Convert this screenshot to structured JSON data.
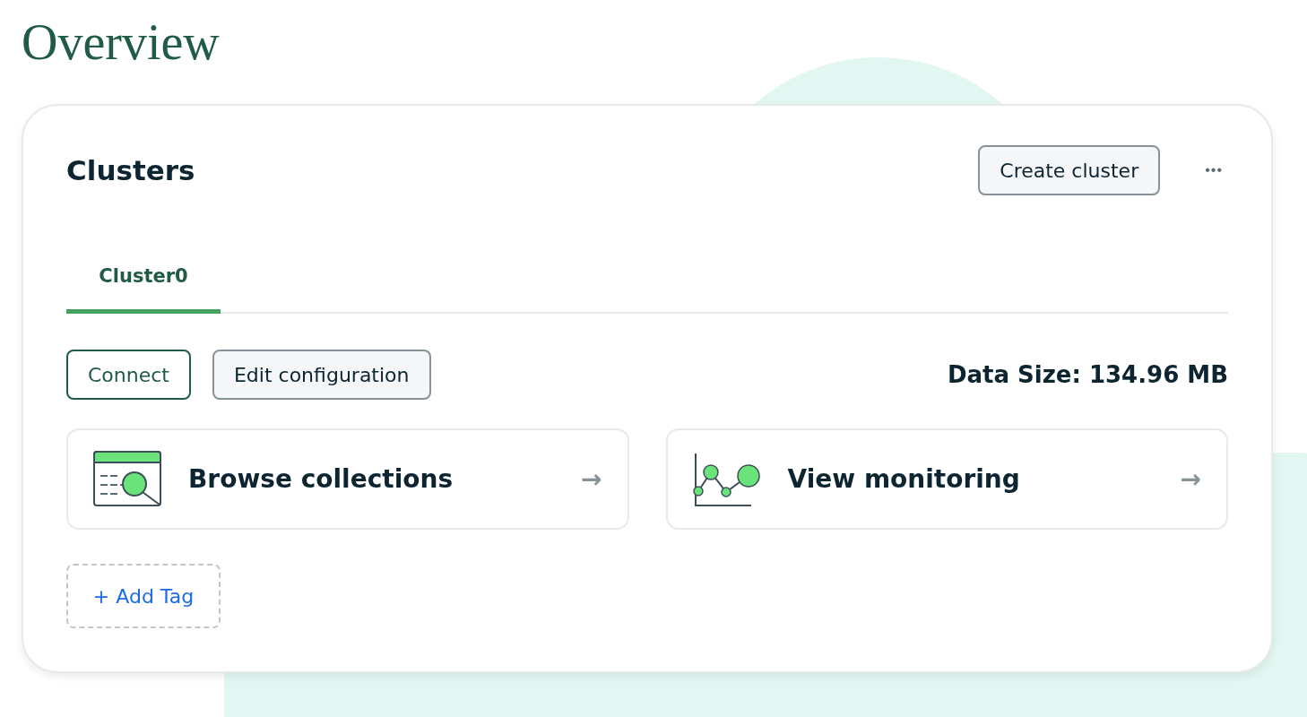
{
  "title": "Overview",
  "card": {
    "heading": "Clusters",
    "create_button": "Create cluster",
    "more_button": "•••",
    "tabs": [
      {
        "label": "Cluster0",
        "selected": true
      }
    ],
    "actions": [
      {
        "label": "Connect",
        "kind": "primary"
      },
      {
        "label": "Edit configuration",
        "kind": "secondary"
      }
    ],
    "data_size": "Data Size: 134.96 MB",
    "links": [
      {
        "label": "Browse collections",
        "kind": "browse",
        "arrow": "→"
      },
      {
        "label": "View monitoring",
        "kind": "monitor",
        "arrow": "→"
      }
    ],
    "add_tag": "+ Add Tag"
  }
}
